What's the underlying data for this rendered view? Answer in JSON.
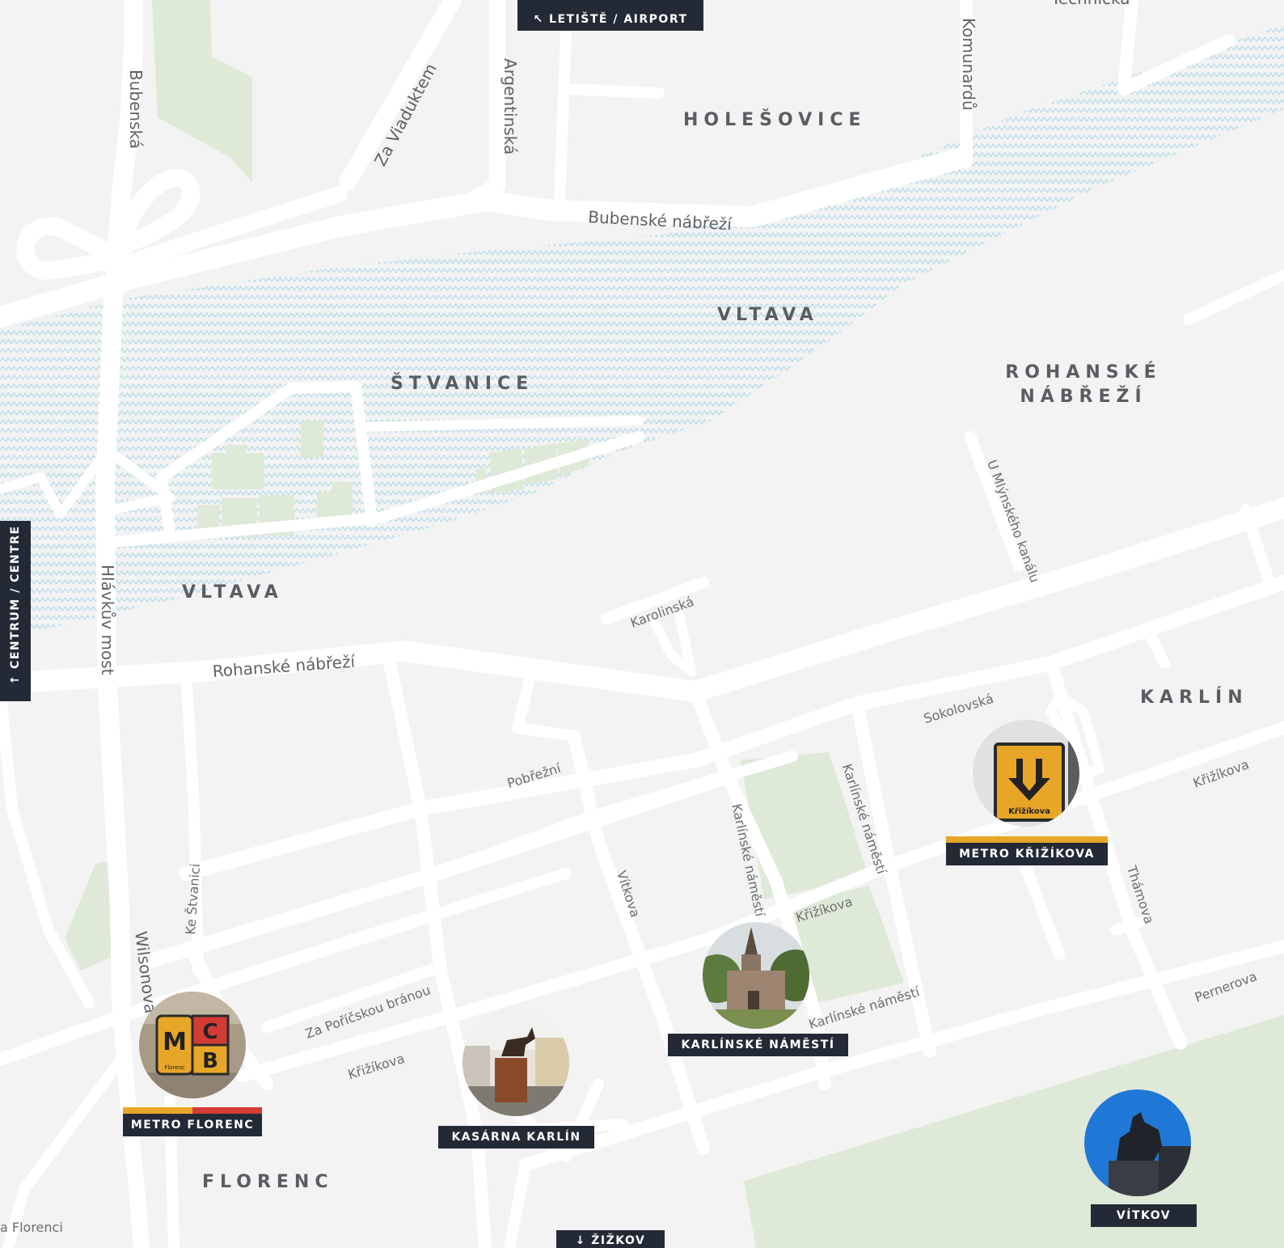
{
  "map": {
    "districts": [
      {
        "id": "holesovice",
        "label": "HOLEŠOVICE"
      },
      {
        "id": "stvanice",
        "label": "ŠTVANICE"
      },
      {
        "id": "rohanske",
        "label": "ROHANSKÉ NÁBŘEŽÍ",
        "line1": "ROHANSKÉ",
        "line2": "NÁBŘEŽÍ"
      },
      {
        "id": "karlin",
        "label": "KARLÍN"
      },
      {
        "id": "florenc",
        "label": "FLORENC"
      }
    ],
    "rivers": [
      {
        "id": "vltava-1",
        "label": "VLTAVA"
      },
      {
        "id": "vltava-2",
        "label": "VLTAVA"
      }
    ],
    "streets": {
      "bubenska": "Bubenská",
      "za_viaduktem": "Za Viaduktem",
      "argentinska": "Argentinská",
      "komunardu": "Komunardů",
      "technicka": "Technická",
      "bubenske_nabrezi": "Bubenské nábřeží",
      "u_mlynskeho_kanalu": "U Mlýnského kanálu",
      "karolinska": "Karolinská",
      "hlavkuv_most": "Hlávkův most",
      "rohanske_nabrezi": "Rohanské nábřeží",
      "sokolovska": "Sokolovská",
      "pobrezni": "Pobřežní",
      "krizikova_1": "Křižíkova",
      "krizikova_2": "Křižíkova",
      "krizikova_3": "Křižíkova",
      "karlinske_namesti_1": "Karlínské náměstí",
      "karlinske_namesti_2": "Karlínské náměstí",
      "karlinske_namesti_3": "Karlínské náměstí",
      "vitkova": "Vítkova",
      "ke_stvanici": "Ke Štvanici",
      "wilsonova": "Wilsonova",
      "za_porickou_branou": "Za Poříčskou bránou",
      "thamova": "Thámova",
      "pernerova": "Pernerova",
      "na_florenci": "a Florenci"
    },
    "pois": [
      {
        "id": "metro-florenc",
        "label": "METRO FLORENC",
        "sign_letters": [
          "M",
          "C",
          "B"
        ],
        "sign_text": "Florenc",
        "line_colors": [
          "#e8a628",
          "#d33b35"
        ]
      },
      {
        "id": "kasarna-karlin",
        "label": "KASÁRNA KARLÍN"
      },
      {
        "id": "karlinske-namesti",
        "label": "KARLÍNSKÉ NÁMĚSTÍ"
      },
      {
        "id": "metro-krizikova",
        "label": "METRO KŘIŽÍKOVA",
        "sign_text": "Křižíkova",
        "line_colors": [
          "#e8a628"
        ]
      },
      {
        "id": "vitkov",
        "label": "VÍTKOV"
      }
    ],
    "nav": {
      "airport": {
        "label": "LETIŠTĚ / AIRPORT",
        "arrow": "↖"
      },
      "centre": {
        "label": "CENTRUM / CENTRE",
        "arrow": "↑"
      },
      "zizkov": {
        "label": "ŽIŽKOV",
        "arrow": "↓"
      }
    },
    "colors": {
      "background": "#f3f3f3",
      "road": "#ffffff",
      "park": "#dfe9d8",
      "water_pattern": "#b8dbe8",
      "label_bg": "#232a36",
      "metro_b_yellow": "#e8a628",
      "metro_c_red": "#d33b35"
    }
  }
}
